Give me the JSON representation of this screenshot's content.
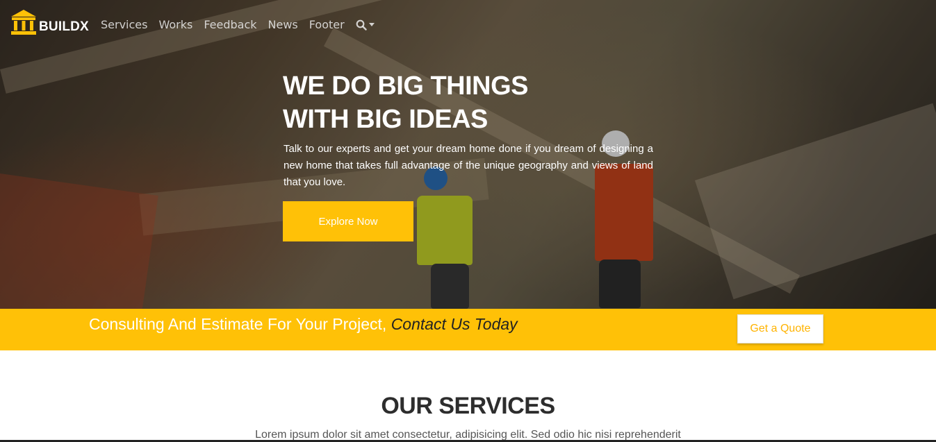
{
  "brand": {
    "name": "BUILDX",
    "accent": "#ffc107"
  },
  "nav": {
    "items": [
      {
        "label": "Services"
      },
      {
        "label": "Works"
      },
      {
        "label": "Feedback"
      },
      {
        "label": "News"
      },
      {
        "label": "Footer"
      }
    ],
    "search_icon": "search-icon"
  },
  "hero": {
    "title_line1": "WE DO BIG THINGS",
    "title_line2": "WITH BIG IDEAS",
    "description": "Talk to our experts and get your dream home done if you dream of designing a new home that takes full advantage of the unique geography and views of land that you love.",
    "cta_label": "Explore Now"
  },
  "cta_bar": {
    "text": "Consulting And Estimate For Your Project,",
    "emphasis": "Contact Us Today",
    "button_label": "Get a Quote"
  },
  "services": {
    "title": "OUR SERVICES",
    "subtitle": "Lorem ipsum dolor sit amet consectetur, adipisicing elit. Sed odio hic nisi reprehenderit"
  }
}
